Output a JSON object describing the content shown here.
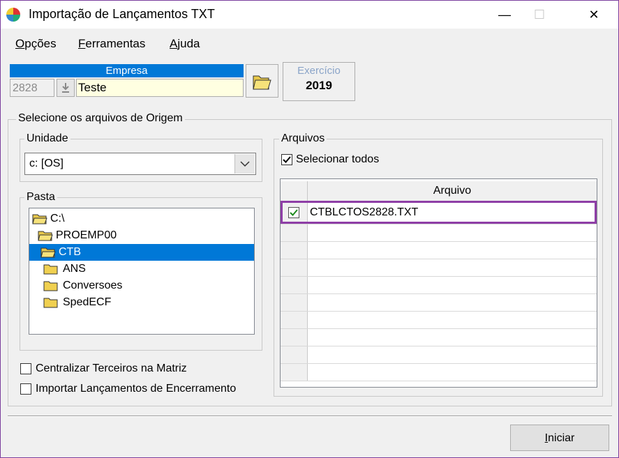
{
  "window": {
    "title": "Importação de Lançamentos TXT",
    "minimize": "—",
    "maximize": "☐",
    "close": "✕"
  },
  "menu": {
    "items": [
      {
        "accel": "O",
        "rest": "pções"
      },
      {
        "accel": "F",
        "rest": "erramentas"
      },
      {
        "accel": "A",
        "rest": "juda"
      }
    ]
  },
  "empresa": {
    "header": "Empresa",
    "code": "2828",
    "name": "Teste"
  },
  "exercicio": {
    "label": "Exercício",
    "value": "2019"
  },
  "origem": {
    "legend": "Selecione os arquivos de Origem"
  },
  "unidade": {
    "legend": "Unidade",
    "selected": "c: [OS]"
  },
  "pasta": {
    "legend": "Pasta",
    "items": [
      "C:\\",
      "PROEMP00",
      "CTB",
      "ANS",
      "Conversoes",
      "SpedECF"
    ],
    "selected_index": 2
  },
  "arquivos": {
    "legend": "Arquivos",
    "select_all_label": "Selecionar todos",
    "select_all_checked": true,
    "column_header": "Arquivo",
    "files": [
      {
        "name": "CTBLCTOS2828.TXT",
        "checked": true
      }
    ]
  },
  "options": {
    "centralizar_label": "Centralizar Terceiros na Matriz",
    "importar_label": "Importar Lançamentos de Encerramento"
  },
  "buttons": {
    "iniciar_accel": "I",
    "iniciar_rest": "niciar"
  },
  "colors": {
    "accent": "#0078d7",
    "highlight": "#8e3ea6",
    "check": "#1e8a1e"
  }
}
